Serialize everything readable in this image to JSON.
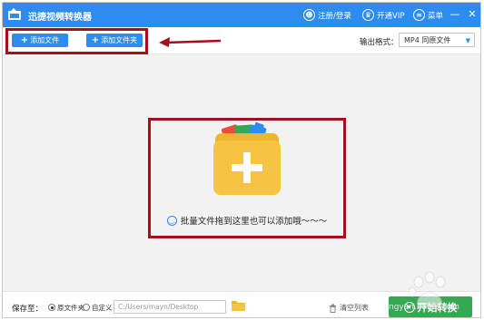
{
  "app": {
    "title": "迅捷视频转换器"
  },
  "titlebar": {
    "login_label": "注册/登录",
    "vip_label": "开通VIP",
    "menu_label": "菜单",
    "minimize": "—",
    "close": "✕"
  },
  "toolbar": {
    "add_file_label": "添加文件",
    "add_folder_label": "添加文件夹",
    "plus": "+",
    "output_format_label": "输出格式：",
    "output_format_value": "MP4  同原文件"
  },
  "main": {
    "drop_hint": "批量文件拖到这里也可以添加哦～～～"
  },
  "bottom": {
    "save_to_label": "保存至：",
    "radio_source_label": "原文件夹",
    "radio_custom_label": "自定义",
    "radio_selected": "source",
    "path_value": "C:/Users/mayn/Desktop",
    "clear_list_label": "清空列表",
    "start_label": "开始转换"
  },
  "watermark": {
    "text": "jingyan.baidu.com"
  },
  "colors": {
    "accent": "#2d8cf0",
    "highlight": "#a50f1c",
    "start": "#34a853",
    "folder": "#f6c343"
  },
  "icons": {
    "app": "app-logo-icon",
    "login": "user-icon",
    "vip": "vip-icon",
    "menu": "menu-icon",
    "folder": "folder-plus-icon",
    "hint": "smile-icon",
    "trash": "trash-icon",
    "start": "play-icon"
  }
}
